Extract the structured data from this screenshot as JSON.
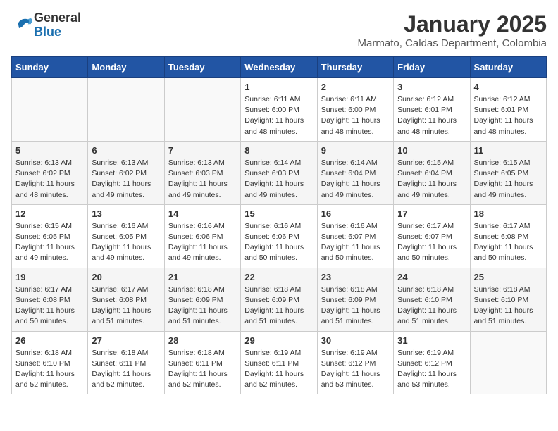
{
  "logo": {
    "general": "General",
    "blue": "Blue"
  },
  "header": {
    "month": "January 2025",
    "location": "Marmato, Caldas Department, Colombia"
  },
  "weekdays": [
    "Sunday",
    "Monday",
    "Tuesday",
    "Wednesday",
    "Thursday",
    "Friday",
    "Saturday"
  ],
  "weeks": [
    [
      {
        "day": "",
        "info": ""
      },
      {
        "day": "",
        "info": ""
      },
      {
        "day": "",
        "info": ""
      },
      {
        "day": "1",
        "info": "Sunrise: 6:11 AM\nSunset: 6:00 PM\nDaylight: 11 hours\nand 48 minutes."
      },
      {
        "day": "2",
        "info": "Sunrise: 6:11 AM\nSunset: 6:00 PM\nDaylight: 11 hours\nand 48 minutes."
      },
      {
        "day": "3",
        "info": "Sunrise: 6:12 AM\nSunset: 6:01 PM\nDaylight: 11 hours\nand 48 minutes."
      },
      {
        "day": "4",
        "info": "Sunrise: 6:12 AM\nSunset: 6:01 PM\nDaylight: 11 hours\nand 48 minutes."
      }
    ],
    [
      {
        "day": "5",
        "info": "Sunrise: 6:13 AM\nSunset: 6:02 PM\nDaylight: 11 hours\nand 48 minutes."
      },
      {
        "day": "6",
        "info": "Sunrise: 6:13 AM\nSunset: 6:02 PM\nDaylight: 11 hours\nand 49 minutes."
      },
      {
        "day": "7",
        "info": "Sunrise: 6:13 AM\nSunset: 6:03 PM\nDaylight: 11 hours\nand 49 minutes."
      },
      {
        "day": "8",
        "info": "Sunrise: 6:14 AM\nSunset: 6:03 PM\nDaylight: 11 hours\nand 49 minutes."
      },
      {
        "day": "9",
        "info": "Sunrise: 6:14 AM\nSunset: 6:04 PM\nDaylight: 11 hours\nand 49 minutes."
      },
      {
        "day": "10",
        "info": "Sunrise: 6:15 AM\nSunset: 6:04 PM\nDaylight: 11 hours\nand 49 minutes."
      },
      {
        "day": "11",
        "info": "Sunrise: 6:15 AM\nSunset: 6:05 PM\nDaylight: 11 hours\nand 49 minutes."
      }
    ],
    [
      {
        "day": "12",
        "info": "Sunrise: 6:15 AM\nSunset: 6:05 PM\nDaylight: 11 hours\nand 49 minutes."
      },
      {
        "day": "13",
        "info": "Sunrise: 6:16 AM\nSunset: 6:05 PM\nDaylight: 11 hours\nand 49 minutes."
      },
      {
        "day": "14",
        "info": "Sunrise: 6:16 AM\nSunset: 6:06 PM\nDaylight: 11 hours\nand 49 minutes."
      },
      {
        "day": "15",
        "info": "Sunrise: 6:16 AM\nSunset: 6:06 PM\nDaylight: 11 hours\nand 50 minutes."
      },
      {
        "day": "16",
        "info": "Sunrise: 6:16 AM\nSunset: 6:07 PM\nDaylight: 11 hours\nand 50 minutes."
      },
      {
        "day": "17",
        "info": "Sunrise: 6:17 AM\nSunset: 6:07 PM\nDaylight: 11 hours\nand 50 minutes."
      },
      {
        "day": "18",
        "info": "Sunrise: 6:17 AM\nSunset: 6:08 PM\nDaylight: 11 hours\nand 50 minutes."
      }
    ],
    [
      {
        "day": "19",
        "info": "Sunrise: 6:17 AM\nSunset: 6:08 PM\nDaylight: 11 hours\nand 50 minutes."
      },
      {
        "day": "20",
        "info": "Sunrise: 6:17 AM\nSunset: 6:08 PM\nDaylight: 11 hours\nand 51 minutes."
      },
      {
        "day": "21",
        "info": "Sunrise: 6:18 AM\nSunset: 6:09 PM\nDaylight: 11 hours\nand 51 minutes."
      },
      {
        "day": "22",
        "info": "Sunrise: 6:18 AM\nSunset: 6:09 PM\nDaylight: 11 hours\nand 51 minutes."
      },
      {
        "day": "23",
        "info": "Sunrise: 6:18 AM\nSunset: 6:09 PM\nDaylight: 11 hours\nand 51 minutes."
      },
      {
        "day": "24",
        "info": "Sunrise: 6:18 AM\nSunset: 6:10 PM\nDaylight: 11 hours\nand 51 minutes."
      },
      {
        "day": "25",
        "info": "Sunrise: 6:18 AM\nSunset: 6:10 PM\nDaylight: 11 hours\nand 51 minutes."
      }
    ],
    [
      {
        "day": "26",
        "info": "Sunrise: 6:18 AM\nSunset: 6:10 PM\nDaylight: 11 hours\nand 52 minutes."
      },
      {
        "day": "27",
        "info": "Sunrise: 6:18 AM\nSunset: 6:11 PM\nDaylight: 11 hours\nand 52 minutes."
      },
      {
        "day": "28",
        "info": "Sunrise: 6:18 AM\nSunset: 6:11 PM\nDaylight: 11 hours\nand 52 minutes."
      },
      {
        "day": "29",
        "info": "Sunrise: 6:19 AM\nSunset: 6:11 PM\nDaylight: 11 hours\nand 52 minutes."
      },
      {
        "day": "30",
        "info": "Sunrise: 6:19 AM\nSunset: 6:12 PM\nDaylight: 11 hours\nand 53 minutes."
      },
      {
        "day": "31",
        "info": "Sunrise: 6:19 AM\nSunset: 6:12 PM\nDaylight: 11 hours\nand 53 minutes."
      },
      {
        "day": "",
        "info": ""
      }
    ]
  ]
}
